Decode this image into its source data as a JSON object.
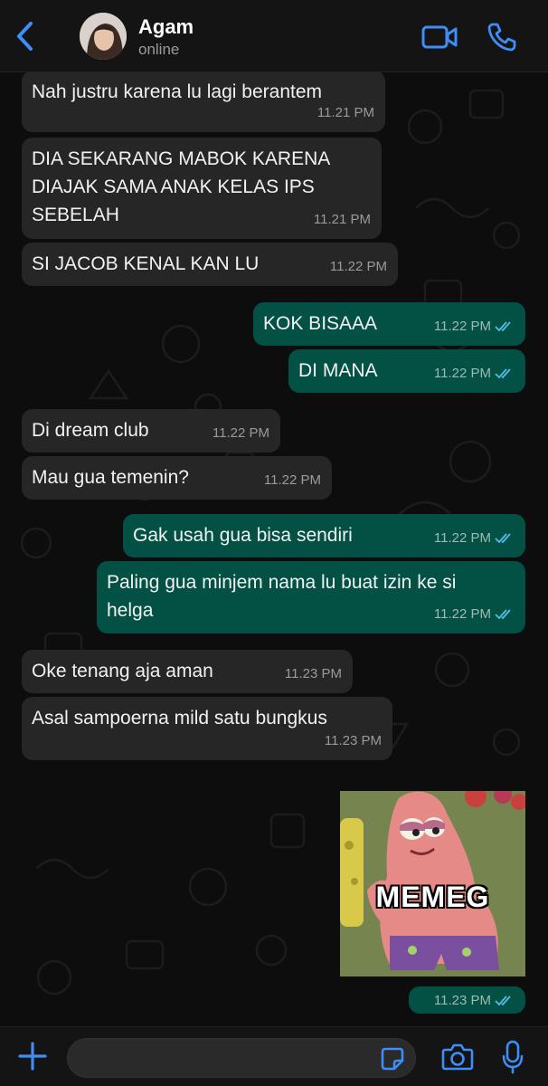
{
  "header": {
    "contact_name": "Agam",
    "status": "online",
    "back_icon": "chevron-left-icon",
    "video_icon": "video-camera-icon",
    "call_icon": "phone-icon"
  },
  "colors": {
    "accent": "#3d8ef7",
    "incoming_bubble": "#262626",
    "outgoing_bubble": "#025144",
    "read_ticks": "#53bdeb"
  },
  "messages": [
    {
      "direction": "in",
      "text": "Nah justru karena lu lagi berantem",
      "time": "11.21 PM"
    },
    {
      "direction": "in",
      "text": "DIA SEKARANG MABOK KARENA\nDIAJAK SAMA ANAK KELAS IPS\nSEBELAH",
      "time": "11.21 PM"
    },
    {
      "direction": "in",
      "text": "SI JACOB KENAL KAN LU",
      "time": "11.22 PM"
    },
    {
      "direction": "out",
      "text": "KOK BISAAA",
      "time": "11.22 PM"
    },
    {
      "direction": "out",
      "text": "DI MANA",
      "time": "11.22 PM"
    },
    {
      "direction": "in",
      "text": "Di dream club",
      "time": "11.22 PM"
    },
    {
      "direction": "in",
      "text": "Mau gua temenin?",
      "time": "11.22 PM"
    },
    {
      "direction": "out",
      "text": "Gak usah gua bisa sendiri",
      "time": "11.22 PM"
    },
    {
      "direction": "out",
      "text": "Paling gua minjem nama lu buat izin ke si\nhelga",
      "time": "11.22 PM"
    },
    {
      "direction": "in",
      "text": "Oke tenang aja aman",
      "time": "11.23 PM"
    },
    {
      "direction": "in",
      "text": "Asal sampoerna mild satu bungkus",
      "time": "11.23 PM"
    }
  ],
  "sticker": {
    "caption": "MEMEG",
    "time": "11.23 PM"
  },
  "inputbar": {
    "plus_icon": "plus-icon",
    "sticker_icon": "sticker-icon",
    "camera_icon": "camera-icon",
    "mic_icon": "microphone-icon"
  }
}
